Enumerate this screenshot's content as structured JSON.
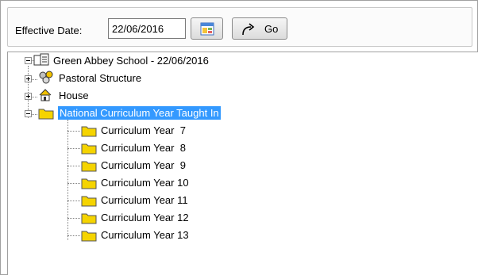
{
  "toolbar": {
    "effective_date_label": "Effective Date:",
    "date_value": "22/06/2016",
    "go_label": "Go"
  },
  "tree": {
    "root": "Green Abbey School - 22/06/2016",
    "children": [
      {
        "label": "Pastoral Structure",
        "expanded": false
      },
      {
        "label": "House",
        "expanded": false
      },
      {
        "label": "National Curriculum Year Taught In",
        "expanded": true,
        "selected": true,
        "children": [
          "Curriculum Year  7",
          "Curriculum Year  8",
          "Curriculum Year  9",
          "Curriculum Year 10",
          "Curriculum Year 11",
          "Curriculum Year 12",
          "Curriculum Year 13"
        ]
      }
    ]
  },
  "colors": {
    "selection": "#3399ff",
    "folder": "#f5d400"
  }
}
